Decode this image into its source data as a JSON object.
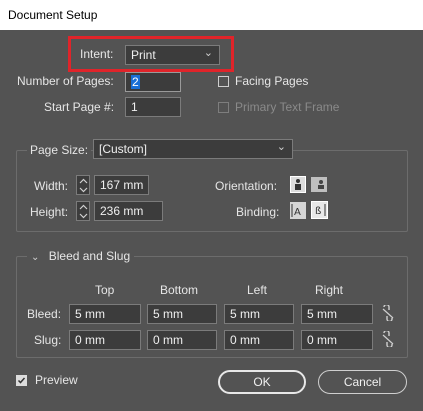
{
  "window": {
    "title": "Document Setup"
  },
  "intent": {
    "label": "Intent:",
    "value": "Print"
  },
  "pages": {
    "number_label": "Number of Pages:",
    "number_value": "2",
    "start_label": "Start Page #:",
    "start_value": "1",
    "facing_label": "Facing Pages",
    "primary_label": "Primary Text Frame"
  },
  "page_size": {
    "legend": "Page Size:",
    "value": "[Custom]",
    "width_label": "Width:",
    "width_value": "167 mm",
    "height_label": "Height:",
    "height_value": "236 mm",
    "orientation_label": "Orientation:",
    "binding_label": "Binding:"
  },
  "bleed_slug": {
    "legend": "Bleed and Slug",
    "headers": [
      "Top",
      "Bottom",
      "Left",
      "Right"
    ],
    "bleed_label": "Bleed:",
    "bleed": [
      "5 mm",
      "5 mm",
      "5 mm",
      "5 mm"
    ],
    "slug_label": "Slug:",
    "slug": [
      "0 mm",
      "0 mm",
      "0 mm",
      "0 mm"
    ]
  },
  "footer": {
    "preview_label": "Preview",
    "preview_checked": true,
    "ok_label": "OK",
    "cancel_label": "Cancel"
  },
  "colors": {
    "highlight": "#e0242a",
    "panel": "#535353",
    "field": "#3c3c3c"
  }
}
